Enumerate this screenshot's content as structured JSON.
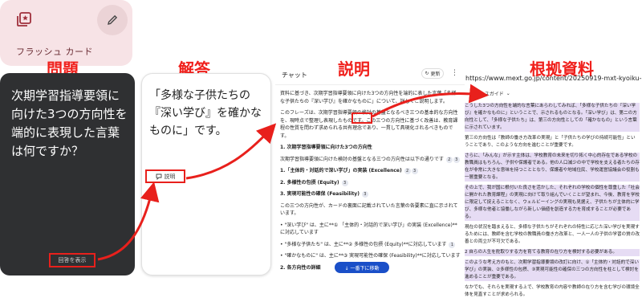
{
  "flashcard": {
    "title": "フラッシュ カード",
    "question": "次期学習指導要領に向けた3つの方向性を端的に表現した言葉は何ですか？",
    "show_answer": "回答を表示",
    "answer": "「多様な子供たちの『深い学び』を確かなものに」です。",
    "explain": "説明"
  },
  "labels": {
    "question": "問題",
    "answer": "解答",
    "explain": "説明",
    "source": "根拠資料"
  },
  "chat": {
    "title": "チャット",
    "update": "更新",
    "jump": "↓ 一番下に移動",
    "p1": "資料に基づき、次期学習指導要領に向けた3つの方向性を端的に表した言葉「多様な子供たちの『深い学び』を確かなものに」について、詳しくご説明します。",
    "p2": "このフレーズは、次期学習指導要領の検討の基盤となるべき三つの基本的な方向性を、現時点で整理し表現したものです。この三つの方向性に基づく改善は、教育課程の性質を問わず求められる共有理念であり、一貫して具現化されるべきものです。",
    "h1": "1. 次期学習指導要領に向けた3つの方向性",
    "p3": "次期学習指導要領に向けた検討の基盤となる三つの方向性は以下の通りです",
    "items": [
      "1.「主体的・対話的で深い学び」の実装 (Excellence)",
      "2. 多様性の包摂 (Equity)",
      "3. 実現可能性の確保 (Feasibility)"
    ],
    "p4": "この三つの方向性が、カードの裏面に記載されていた言葉の各要素に直に示されています。",
    "bullets": [
      "\"深い学び\" は、主に**① 「主体的・対話的で深い学び」の実装 (Excellence)**に対応しています",
      "\"多様な子供たち\" は、主に**② 多様性の包摂 (Equity)**に対応しています",
      "\"確かなものに\" は、主に**③ 実現可能性の確保 (Feasibility)**に対応しています"
    ],
    "h2": "2. 各方向性の詳細",
    "cites": [
      "1",
      "2",
      "3"
    ]
  },
  "source": {
    "url": "https://www.mext.go.jp/content/20250919-mxt-kyoiku-000...",
    "guide": "ソースガイド",
    "paragraphs": [
      "こうした3つの方向性を端的な言葉にあらわしてみれば、「多様な子供たちの『深い学び』を確かなものに」ということで、示されるものとなる。「深い学び」は、第二の方向性として、「多様な子供たち」は、第三の方向性としての「確かなもの」という言葉に示されています。",
      "第三の方向性は「教師の働き方改革の実現」と「子供たちの学びの持続可能性」ということであり、このような方向を進むことが重要です。",
      "さらに、「みんな」が示す主体は、学校教育の未来を切り拓く中心的存在である学校の教職員はもちろん、子供や保護者である。他の人口減少の中で学校を支える者たちの存在が非常に大きな意味を持つこととなり、保護者や地域住民、学校運営協議会の役割も一層重要となる。",
      "その上で、我が国に根付いた良さを活かした、それぞれの学校の個性を尊重した「社会に開かれた教育課程」の実現に向けて取り組んでいくことが望まれ、今後、教育を学校に限定して捉えることなく、ウェルビーイングの実現も見据え、子供たちが主体的に学び、多様な他者と協働しながら新しい価値を創造する力を育成することが必要である。",
      "現在の状況を踏まえると、多様な子供たちがそれぞれの特性に応じた深い学びを実現するためには、教師を含む学校の教職員の働き方改革と、一人一人の子供の学習の質の改善との両立が不可欠である。",
      "2 自らの人生を舵取りする力を育てる教育の在り方を検討する必要がある。",
      "このような考え方のもと、次期学習指導要領の改訂に向け、①「主体的・対話的で深い学び」の実装、②多様性の包摂、③実現可能性の確保の三つの方向性を柱として検討を進めることが重要である。",
      "なかでも、それらを実現する上で、学校教育の内容や教師の在り方を含む学びの環境全体を見直すことが求められる。"
    ]
  }
}
